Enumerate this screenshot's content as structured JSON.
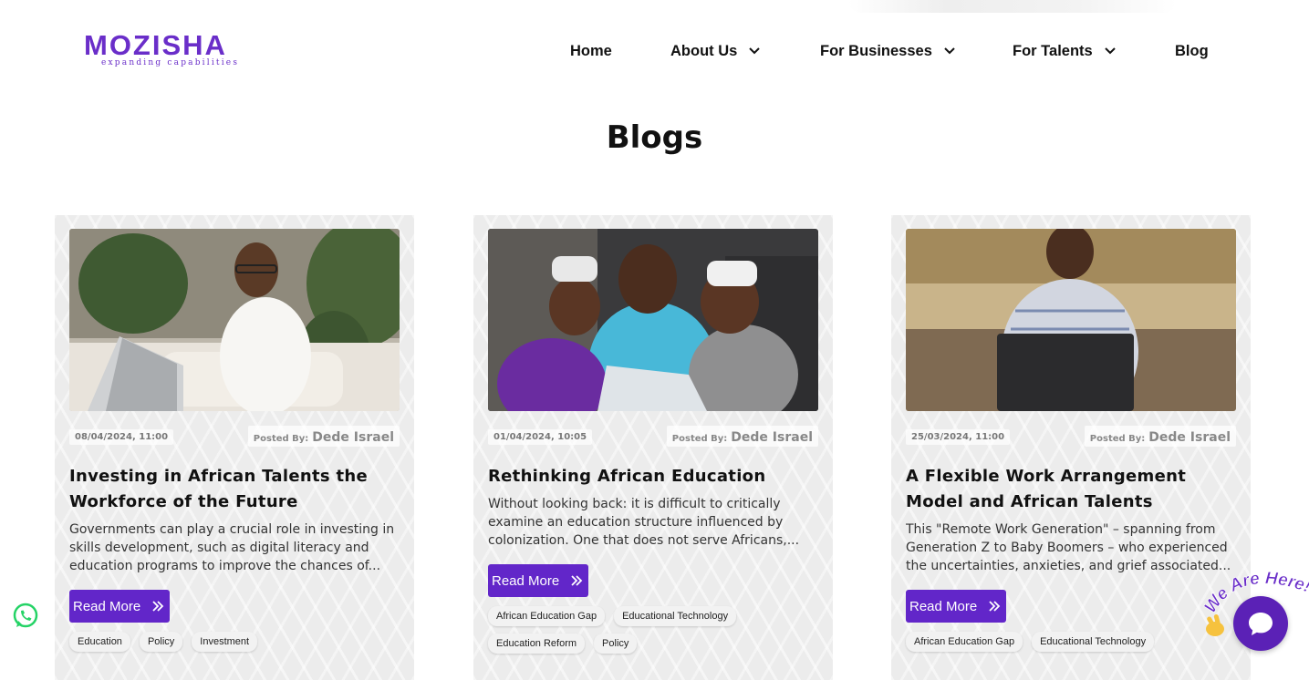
{
  "brand": {
    "name": "MOZISHA",
    "tagline": "expanding capabilities",
    "color": "#6a2ec9"
  },
  "nav": {
    "home": "Home",
    "about": "About Us",
    "businesses": "For Businesses",
    "talents": "For Talents",
    "blog": "Blog"
  },
  "page": {
    "title": "Blogs"
  },
  "posted_by_label": "Posted By:",
  "read_more_label": "Read More",
  "cards": [
    {
      "date": "08/04/2024, 11:00",
      "author": "Dede Israel",
      "title": "Investing in African Talents the Workforce of the Future",
      "excerpt": "Governments can play a crucial role in investing in skills development, such as digital literacy and education programs to improve the chances of...",
      "tags": [
        "Education",
        "Policy",
        "Investment"
      ],
      "image": "man-with-laptop-photo"
    },
    {
      "date": "01/04/2024, 10:05",
      "author": "Dede Israel",
      "title": "Rethinking African Education",
      "excerpt": "Without looking back: it is difficult to critically examine an education structure influenced by colonization. One that does not serve Africans,...",
      "tags": [
        "African Education Gap",
        "Educational Technology",
        "Education Reform",
        "Policy"
      ],
      "image": "children-with-vr-headsets-photo"
    },
    {
      "date": "25/03/2024, 11:00",
      "author": "Dede Israel",
      "title": "A Flexible Work Arrangement Model and African Talents",
      "excerpt": "This \"Remote Work Generation\" – spanning from Generation Z to Baby Boomers – who experienced the uncertainties, anxieties, and grief associated...",
      "tags": [
        "African Education Gap",
        "Educational Technology"
      ],
      "image": "woman-with-laptop-photo"
    }
  ],
  "widgets": {
    "chat_badge": "We Are Here!",
    "whatsapp": "whatsapp-icon",
    "chat": "chat-bubble-icon"
  },
  "colors": {
    "accent": "#6226c9",
    "whatsapp": "#25d366",
    "chat": "#5b21b6"
  }
}
